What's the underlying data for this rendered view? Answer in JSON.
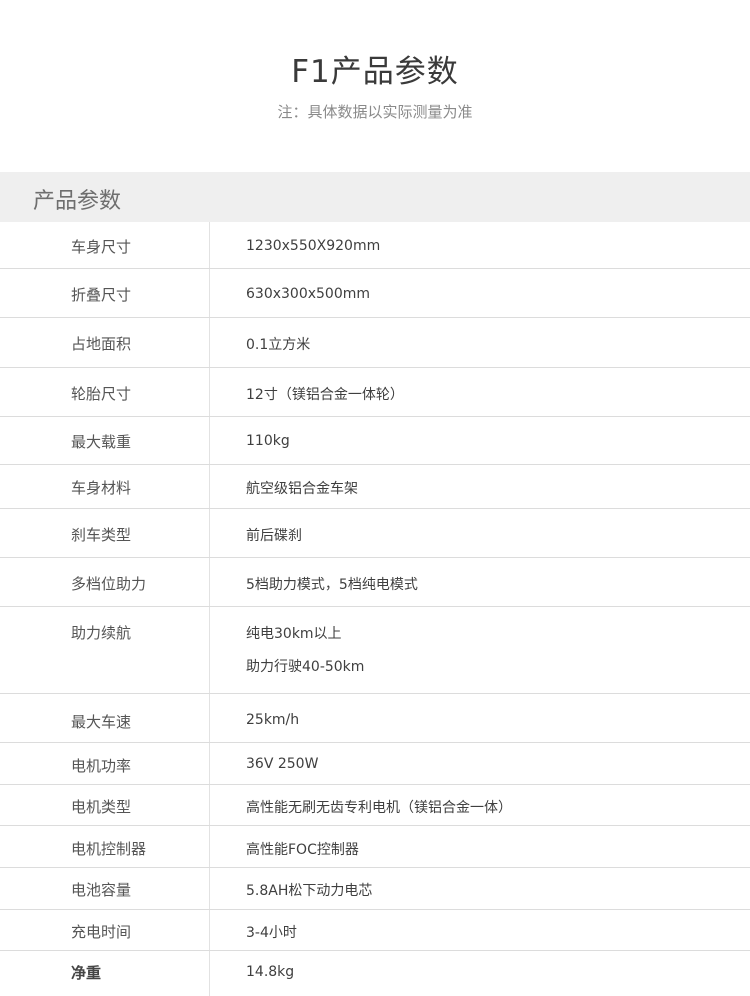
{
  "header": {
    "title": "F1产品参数",
    "note": "注：具体数据以实际测量为准"
  },
  "section": {
    "title": "产品参数"
  },
  "specs": [
    {
      "label": "车身尺寸",
      "value": "1230x550X920mm"
    },
    {
      "label": "折叠尺寸",
      "value": "630x300x500mm"
    },
    {
      "label": "占地面积",
      "value": "0.1立方米"
    },
    {
      "label": "轮胎尺寸",
      "value": "12寸（镁铝合金一体轮）"
    },
    {
      "label": "最大载重",
      "value": "110kg"
    },
    {
      "label": "车身材料",
      "value": "航空级铝合金车架"
    },
    {
      "label": "刹车类型",
      "value": "前后碟刹"
    },
    {
      "label": "多档位助力",
      "value": "5档助力模式，5档纯电模式"
    },
    {
      "label": "助力续航",
      "value": "纯电30km以上",
      "value2": "助力行驶40-50km"
    },
    {
      "label": "最大车速",
      "value": "25km/h"
    },
    {
      "label": "电机功率",
      "value": "36V 250W"
    },
    {
      "label": "电机类型",
      "value": "高性能无刷无齿专利电机（镁铝合金一体）"
    },
    {
      "label": "电机控制器",
      "value": "高性能FOC控制器"
    },
    {
      "label": "电池容量",
      "value": "5.8AH松下动力电芯"
    },
    {
      "label": "充电时间",
      "value": "3-4小时"
    },
    {
      "label": "净重",
      "value": "14.8kg"
    }
  ]
}
